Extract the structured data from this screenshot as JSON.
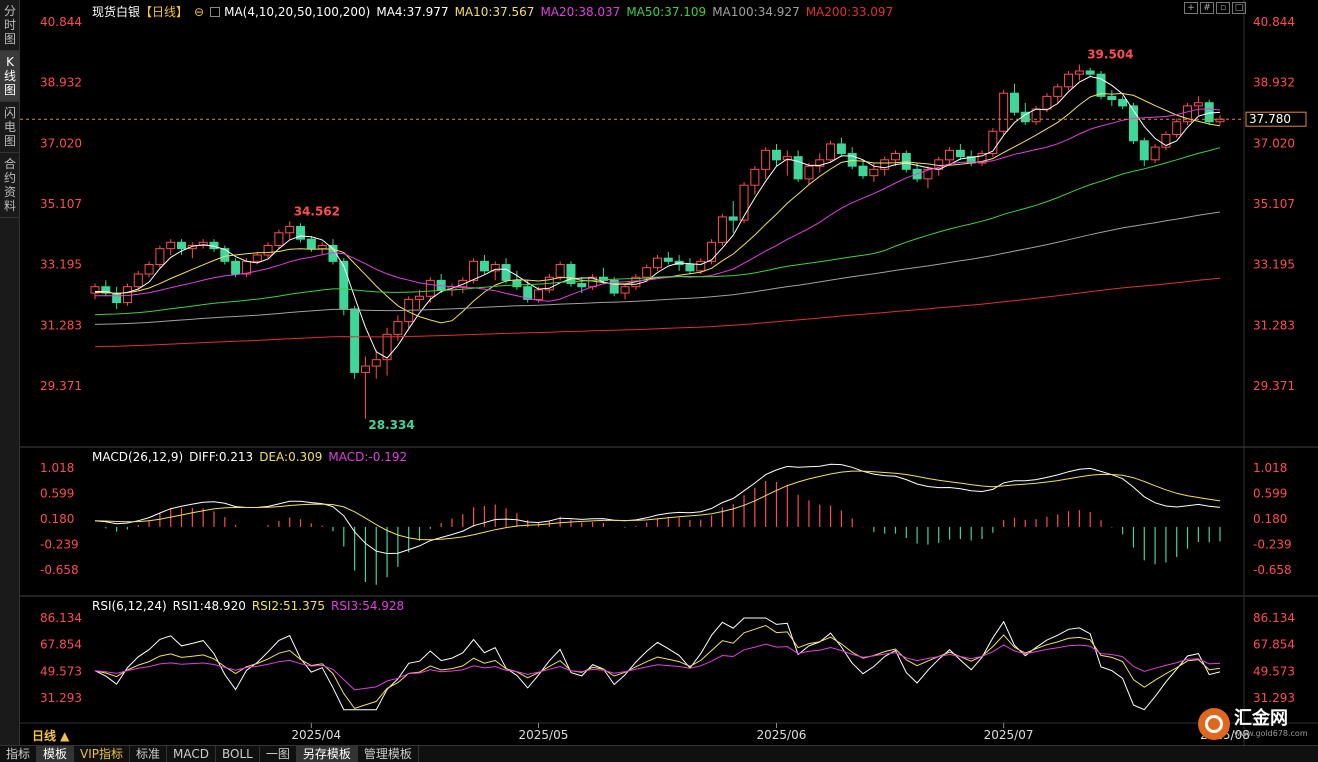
{
  "left_tabs": [
    {
      "label": "分时图",
      "active": false
    },
    {
      "label": "K线图",
      "active": true
    },
    {
      "label": "闪电图",
      "active": false
    },
    {
      "label": "合约资料",
      "active": false
    }
  ],
  "header": {
    "symbol": "现货白银",
    "period": "【日线】",
    "ma_params": "MA(4,10,20,50,100,200)",
    "ma4": "MA4:37.977",
    "ma10": "MA10:37.567",
    "ma20": "MA20:38.037",
    "ma50": "MA50:37.109",
    "ma100": "MA100:34.927",
    "ma200": "MA200:33.097"
  },
  "price_axis": [
    "40.844",
    "38.932",
    "37.020",
    "35.107",
    "33.195",
    "31.283",
    "29.371"
  ],
  "current_price": "37.780",
  "annotations": {
    "high": "39.504",
    "mid_high": "34.562",
    "low": "28.334"
  },
  "macd": {
    "label": "MACD(26,12,9)",
    "diff": "DIFF:0.213",
    "dea": "DEA:0.309",
    "macd": "MACD:-0.192",
    "axis": [
      "1.018",
      "0.599",
      "0.180",
      "-0.239",
      "-0.658"
    ]
  },
  "rsi": {
    "label": "RSI(6,12,24)",
    "rsi1": "RSI1:48.920",
    "rsi2": "RSI2:51.375",
    "rsi3": "RSI3:54.928",
    "axis": [
      "86.134",
      "67.854",
      "49.573",
      "31.293"
    ]
  },
  "dates": [
    "2025/04",
    "2025/05",
    "2025/06",
    "2025/07",
    "2025/08"
  ],
  "day_button": "日线 ▲",
  "toolbar": [
    {
      "label": "指标",
      "sel": false,
      "vip": false
    },
    {
      "label": "模板",
      "sel": true,
      "vip": false
    },
    {
      "label": "VIP指标",
      "sel": false,
      "vip": true
    },
    {
      "label": "标准",
      "sel": false,
      "vip": false
    },
    {
      "label": "MACD",
      "sel": false,
      "vip": false
    },
    {
      "label": "BOLL",
      "sel": false,
      "vip": false
    },
    {
      "label": "一图",
      "sel": false,
      "vip": false
    },
    {
      "label": "另存模板",
      "sel": true,
      "vip": false
    },
    {
      "label": "管理模板",
      "sel": false,
      "vip": false
    }
  ],
  "logo": {
    "name": "汇金网",
    "url": "www.gold678.com"
  },
  "colors": {
    "up": "#ff4d4d",
    "down": "#3fd69a",
    "ma4": "#ffffff",
    "ma10": "#f0e060",
    "ma20": "#e040e0",
    "ma50": "#40d040",
    "ma100": "#a0a0a0",
    "ma200": "#e03030",
    "axis_text": "#ff4d4d"
  },
  "chart_data": {
    "type": "candlestick",
    "ylim": [
      28.334,
      40.844
    ],
    "candles": [
      [
        32.3,
        32.6,
        32.1,
        32.5
      ],
      [
        32.5,
        32.7,
        32.2,
        32.3
      ],
      [
        32.3,
        32.5,
        31.8,
        32.0
      ],
      [
        32.0,
        32.6,
        31.9,
        32.5
      ],
      [
        32.5,
        33.0,
        32.4,
        32.9
      ],
      [
        32.9,
        33.3,
        32.8,
        33.2
      ],
      [
        33.2,
        33.8,
        33.1,
        33.7
      ],
      [
        33.7,
        34.0,
        33.5,
        33.9
      ],
      [
        33.9,
        34.0,
        33.5,
        33.7
      ],
      [
        33.7,
        33.9,
        33.4,
        33.8
      ],
      [
        33.8,
        34.0,
        33.7,
        33.9
      ],
      [
        33.9,
        34.0,
        33.6,
        33.7
      ],
      [
        33.7,
        33.8,
        33.2,
        33.3
      ],
      [
        33.3,
        33.4,
        32.8,
        32.9
      ],
      [
        32.9,
        33.4,
        32.8,
        33.3
      ],
      [
        33.3,
        33.6,
        33.2,
        33.5
      ],
      [
        33.5,
        33.9,
        33.4,
        33.8
      ],
      [
        33.8,
        34.3,
        33.7,
        34.2
      ],
      [
        34.2,
        34.56,
        34.0,
        34.4
      ],
      [
        34.4,
        34.5,
        33.9,
        34.0
      ],
      [
        34.0,
        34.1,
        33.6,
        33.7
      ],
      [
        33.7,
        33.9,
        33.5,
        33.8
      ],
      [
        33.8,
        34.0,
        33.2,
        33.3
      ],
      [
        33.3,
        33.4,
        31.6,
        31.8
      ],
      [
        31.8,
        31.9,
        29.6,
        29.8
      ],
      [
        29.8,
        30.3,
        28.334,
        30.0
      ],
      [
        30.0,
        30.5,
        29.6,
        30.2
      ],
      [
        30.2,
        31.2,
        29.7,
        31.0
      ],
      [
        31.0,
        31.6,
        30.8,
        31.4
      ],
      [
        31.4,
        32.2,
        31.2,
        32.1
      ],
      [
        32.1,
        32.4,
        31.8,
        32.2
      ],
      [
        32.2,
        32.8,
        32.0,
        32.7
      ],
      [
        32.7,
        32.9,
        32.3,
        32.4
      ],
      [
        32.4,
        32.6,
        32.2,
        32.5
      ],
      [
        32.5,
        32.8,
        32.3,
        32.7
      ],
      [
        32.7,
        33.4,
        32.6,
        33.3
      ],
      [
        33.3,
        33.5,
        32.9,
        33.0
      ],
      [
        33.0,
        33.3,
        32.7,
        33.2
      ],
      [
        33.2,
        33.4,
        32.6,
        32.7
      ],
      [
        32.7,
        33.0,
        32.4,
        32.5
      ],
      [
        32.5,
        32.7,
        32.0,
        32.1
      ],
      [
        32.1,
        32.5,
        32.0,
        32.4
      ],
      [
        32.4,
        32.9,
        32.3,
        32.8
      ],
      [
        32.8,
        33.3,
        32.7,
        33.2
      ],
      [
        33.2,
        33.3,
        32.5,
        32.6
      ],
      [
        32.6,
        32.8,
        32.3,
        32.5
      ],
      [
        32.5,
        32.9,
        32.4,
        32.8
      ],
      [
        32.8,
        33.1,
        32.6,
        32.7
      ],
      [
        32.7,
        32.8,
        32.2,
        32.3
      ],
      [
        32.3,
        32.6,
        32.1,
        32.5
      ],
      [
        32.5,
        32.9,
        32.4,
        32.8
      ],
      [
        32.8,
        33.2,
        32.7,
        33.1
      ],
      [
        33.1,
        33.5,
        33.0,
        33.4
      ],
      [
        33.4,
        33.6,
        33.2,
        33.3
      ],
      [
        33.3,
        33.5,
        33.0,
        33.2
      ],
      [
        33.2,
        33.4,
        32.9,
        33.0
      ],
      [
        33.0,
        33.4,
        32.9,
        33.3
      ],
      [
        33.3,
        34.0,
        33.2,
        33.9
      ],
      [
        33.9,
        34.8,
        33.8,
        34.7
      ],
      [
        34.7,
        35.2,
        34.2,
        34.6
      ],
      [
        34.6,
        35.8,
        34.5,
        35.7
      ],
      [
        35.7,
        36.3,
        35.4,
        36.2
      ],
      [
        36.2,
        36.9,
        35.9,
        36.8
      ],
      [
        36.8,
        37.0,
        36.3,
        36.5
      ],
      [
        36.5,
        36.8,
        36.0,
        36.6
      ],
      [
        36.6,
        36.8,
        35.8,
        35.9
      ],
      [
        35.9,
        36.4,
        35.7,
        36.3
      ],
      [
        36.3,
        36.7,
        36.1,
        36.5
      ],
      [
        36.5,
        37.1,
        36.4,
        37.0
      ],
      [
        37.0,
        37.2,
        36.6,
        36.7
      ],
      [
        36.7,
        36.9,
        36.2,
        36.3
      ],
      [
        36.3,
        36.5,
        35.9,
        36.0
      ],
      [
        36.0,
        36.4,
        35.8,
        36.2
      ],
      [
        36.2,
        36.6,
        36.0,
        36.5
      ],
      [
        36.5,
        36.8,
        36.3,
        36.7
      ],
      [
        36.7,
        36.8,
        36.1,
        36.2
      ],
      [
        36.2,
        36.4,
        35.8,
        35.9
      ],
      [
        35.9,
        36.3,
        35.6,
        36.2
      ],
      [
        36.2,
        36.6,
        36.0,
        36.5
      ],
      [
        36.5,
        36.9,
        36.4,
        36.8
      ],
      [
        36.8,
        37.0,
        36.5,
        36.6
      ],
      [
        36.6,
        36.8,
        36.3,
        36.4
      ],
      [
        36.4,
        36.8,
        36.3,
        36.7
      ],
      [
        36.7,
        37.5,
        36.6,
        37.4
      ],
      [
        37.4,
        38.7,
        37.3,
        38.6
      ],
      [
        38.6,
        38.9,
        37.9,
        38.0
      ],
      [
        38.0,
        38.3,
        37.6,
        37.7
      ],
      [
        37.7,
        38.2,
        37.6,
        38.1
      ],
      [
        38.1,
        38.6,
        38.0,
        38.5
      ],
      [
        38.5,
        38.9,
        38.3,
        38.8
      ],
      [
        38.8,
        39.3,
        38.7,
        39.2
      ],
      [
        39.2,
        39.504,
        39.0,
        39.3
      ],
      [
        39.3,
        39.4,
        39.1,
        39.2
      ],
      [
        39.2,
        39.3,
        38.4,
        38.5
      ],
      [
        38.5,
        38.7,
        38.2,
        38.4
      ],
      [
        38.4,
        38.5,
        38.1,
        38.2
      ],
      [
        38.2,
        38.3,
        37.0,
        37.1
      ],
      [
        37.1,
        37.2,
        36.3,
        36.5
      ],
      [
        36.5,
        37.0,
        36.4,
        36.9
      ],
      [
        36.9,
        37.4,
        36.8,
        37.3
      ],
      [
        37.3,
        37.8,
        37.2,
        37.7
      ],
      [
        37.7,
        38.3,
        37.6,
        38.2
      ],
      [
        38.2,
        38.5,
        37.9,
        38.3
      ],
      [
        38.3,
        38.4,
        37.6,
        37.7
      ],
      [
        37.7,
        37.9,
        37.6,
        37.78
      ]
    ]
  }
}
